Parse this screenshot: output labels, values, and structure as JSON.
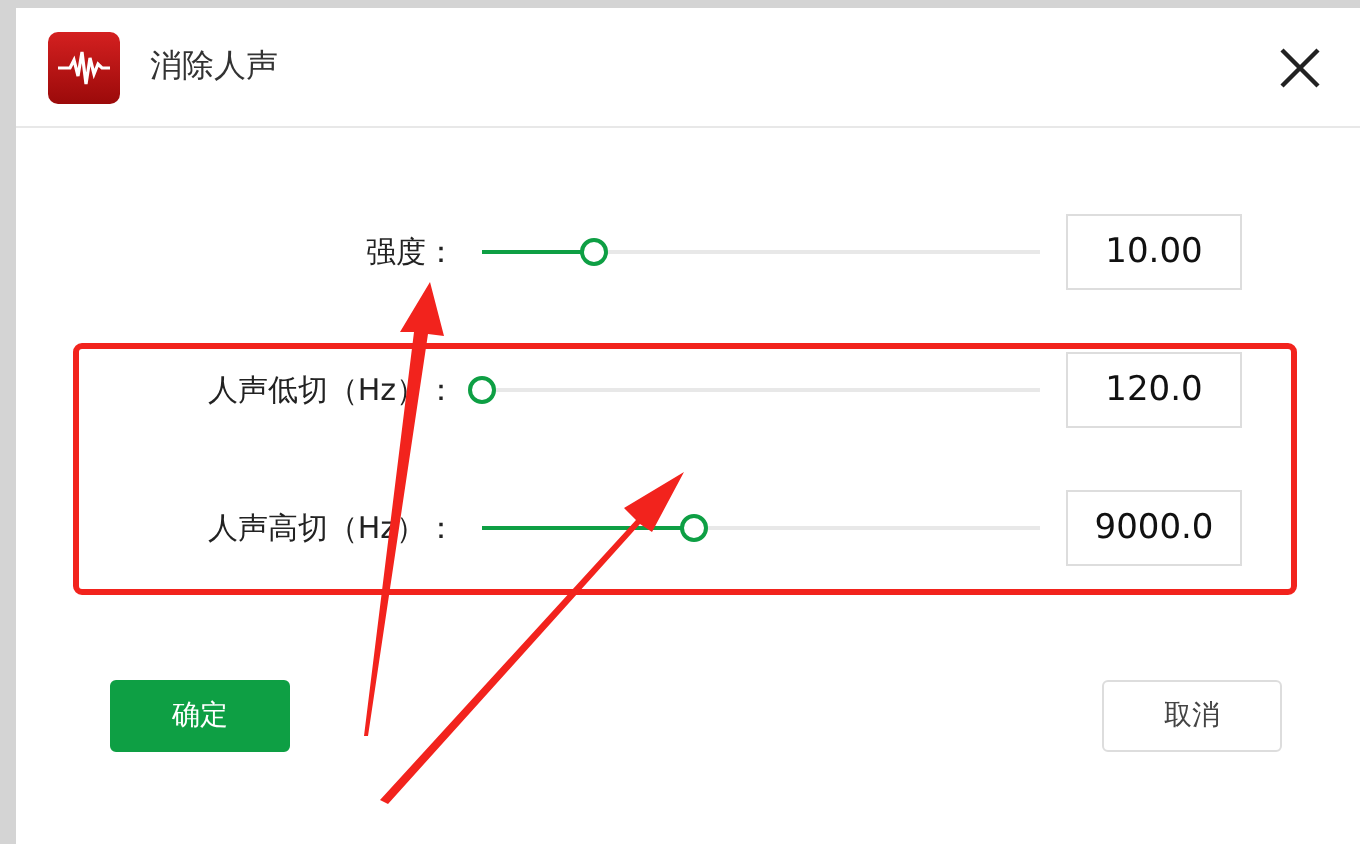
{
  "window": {
    "title": "消除人声"
  },
  "settings": [
    {
      "label": "强度：",
      "level": 0.2,
      "value": "10.00"
    },
    {
      "label": "人声低切（Hz）：",
      "level": 0,
      "value": "120.0"
    },
    {
      "label": "人声高切（Hz）：",
      "level": 0.38,
      "value": "9000.0"
    }
  ],
  "buttons": {
    "confirm": "确定",
    "cancel": "取消"
  }
}
